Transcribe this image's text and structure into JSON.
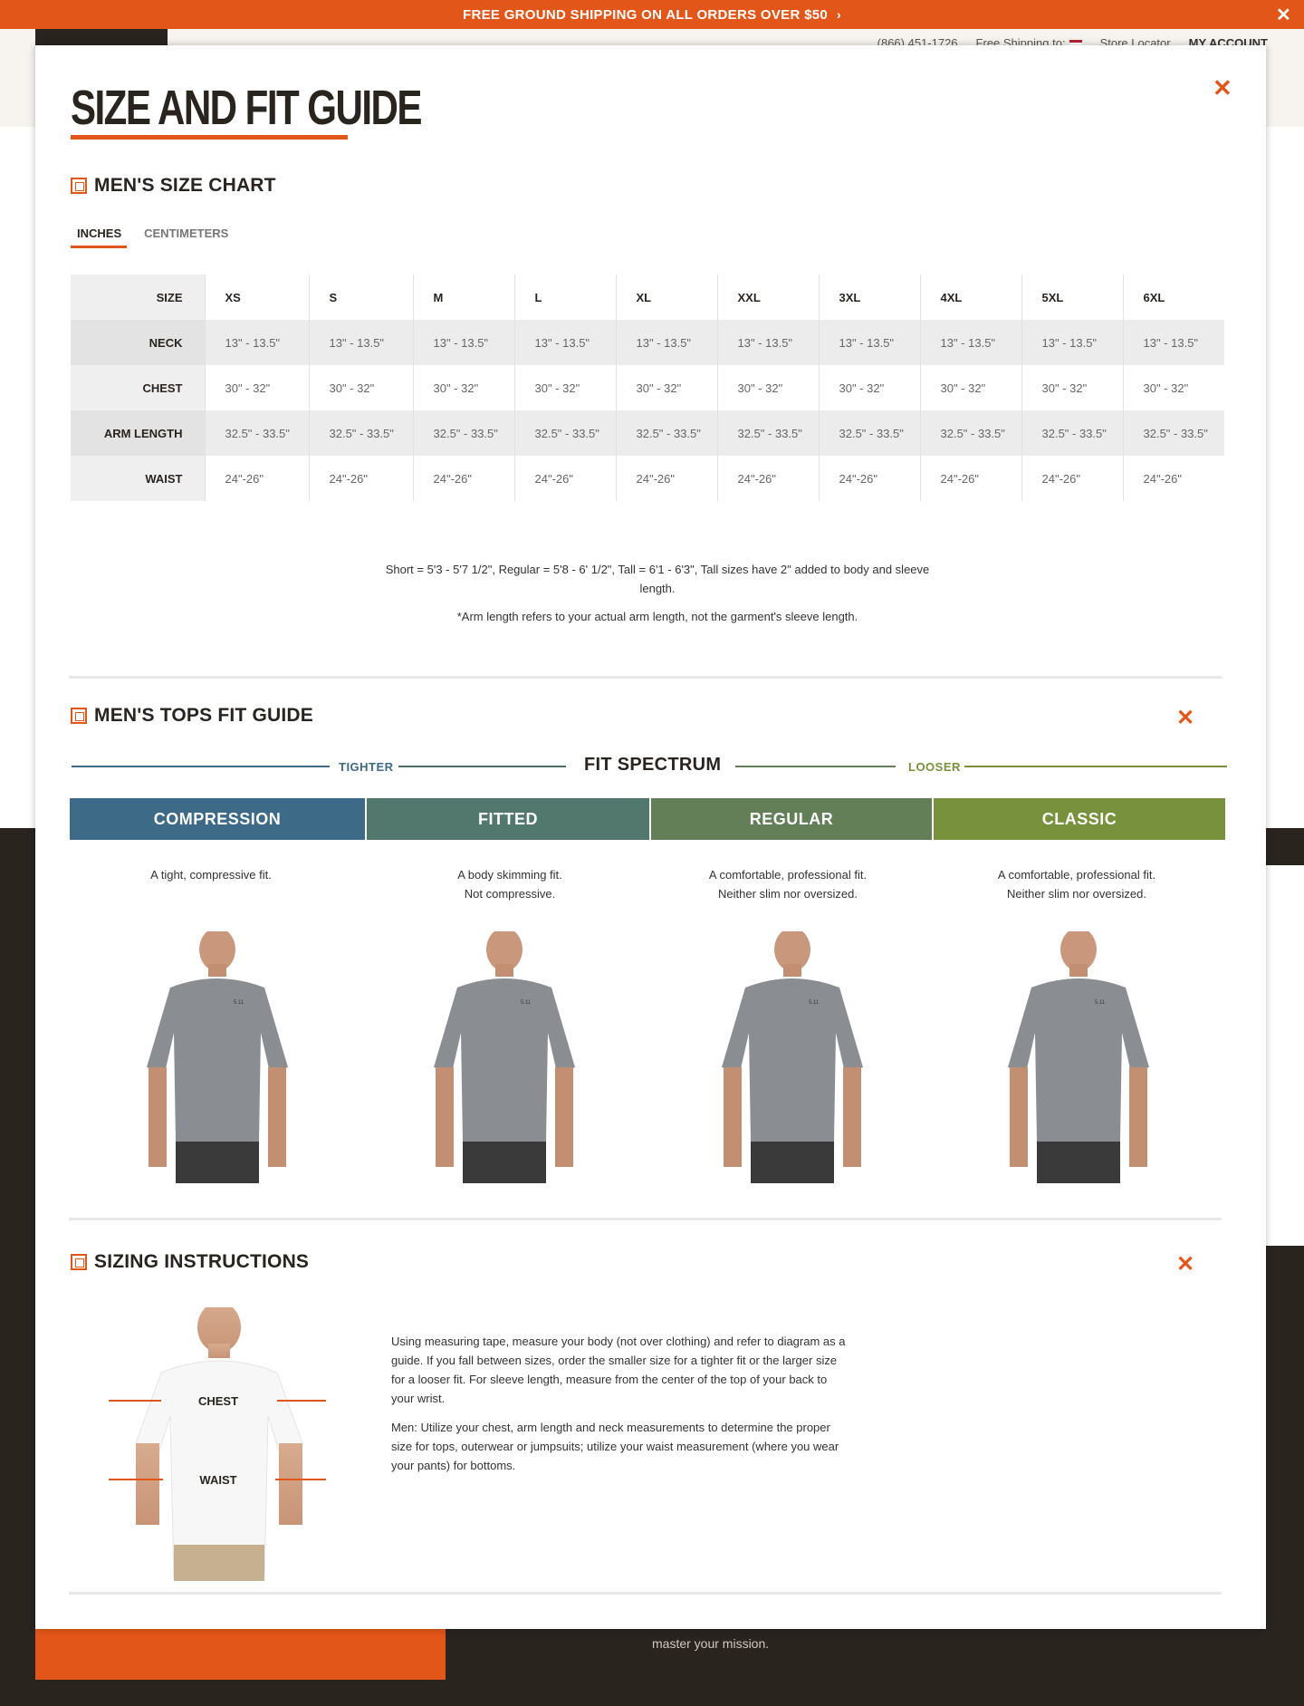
{
  "promo": {
    "text": "FREE GROUND SHIPPING ON ALL ORDERS OVER $50",
    "chevron": "›",
    "close": "✕"
  },
  "util": {
    "phone": "(866) 451-1726",
    "shipping": "Free Shipping to:",
    "store": "Store Locator",
    "account": "MY ACCOUNT"
  },
  "modal": {
    "title": "SIZE AND FIT GUIDE",
    "close": "✕"
  },
  "size_chart": {
    "heading": "MEN'S SIZE CHART",
    "tabs": [
      {
        "label": "INCHES",
        "active": true
      },
      {
        "label": "CENTIMETERS",
        "active": false
      }
    ],
    "sizes": [
      "XS",
      "S",
      "M",
      "L",
      "XL",
      "XXL",
      "3XL",
      "4XL",
      "5XL",
      "6XL"
    ],
    "rows": [
      {
        "label": "SIZE"
      },
      {
        "label": "NECK",
        "value": "13\" - 13.5\""
      },
      {
        "label": "CHEST",
        "value": "30\" - 32\""
      },
      {
        "label": "ARM LENGTH",
        "value": "32.5\" - 33.5\""
      },
      {
        "label": "WAIST",
        "value": "24\"-26\""
      }
    ],
    "note1": "Short = 5'3 - 5'7 1/2\", Regular = 5'8 - 6' 1/2\", Tall = 6'1 - 6'3\", Tall sizes have 2\" added to body and sleeve length.",
    "note2": "*Arm length refers to your actual arm length, not the garment's sleeve length."
  },
  "tops_fit": {
    "heading": "MEN'S TOPS FIT GUIDE",
    "close": "✕",
    "spectrum_title": "FIT SPECTRUM",
    "tighter": "TIGHTER",
    "looser": "LOOSER",
    "fits": [
      {
        "name": "COMPRESSION",
        "desc1": "A tight, compressive fit.",
        "desc2": "",
        "color": "#3d6a86"
      },
      {
        "name": "FITTED",
        "desc1": "A body skimming fit.",
        "desc2": "Not compressive.",
        "color": "#52786e"
      },
      {
        "name": "REGULAR",
        "desc1": "A comfortable, professional fit.",
        "desc2": "Neither slim nor oversized.",
        "color": "#627f58"
      },
      {
        "name": "CLASSIC",
        "desc1": "A comfortable, professional fit.",
        "desc2": "Neither slim nor oversized.",
        "color": "#78913c"
      }
    ],
    "shirt_logo": "5.11"
  },
  "sizing": {
    "heading": "SIZING INSTRUCTIONS",
    "close": "✕",
    "chest_label": "CHEST",
    "waist_label": "WAIST",
    "para1": "Using measuring tape, measure your body (not over clothing) and refer to diagram as a guide. If you fall between sizes, order the smaller size for a tighter fit or the larger size for a looser fit. For sleeve length, measure from the center of the top of your back to your wrist.",
    "para2": "Men: Utilize your chest, arm length and neck measurements to determine the proper size for tops, outerwear or jumpsuits; utilize your waist measurement (where you wear your pants) for bottoms."
  },
  "footer": {
    "text": "master your mission."
  }
}
